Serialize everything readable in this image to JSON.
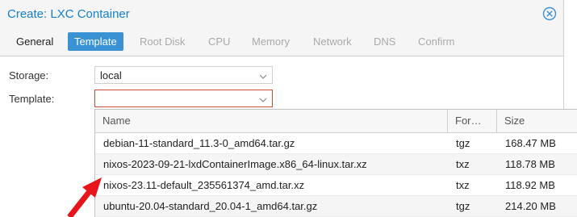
{
  "window": {
    "title": "Create: LXC Container",
    "close_icon": "close-circle-icon"
  },
  "tabs": [
    {
      "label": "General",
      "state": "enabled"
    },
    {
      "label": "Template",
      "state": "active"
    },
    {
      "label": "Root Disk",
      "state": "disabled"
    },
    {
      "label": "CPU",
      "state": "disabled"
    },
    {
      "label": "Memory",
      "state": "disabled"
    },
    {
      "label": "Network",
      "state": "disabled"
    },
    {
      "label": "DNS",
      "state": "disabled"
    },
    {
      "label": "Confirm",
      "state": "disabled"
    }
  ],
  "form": {
    "storage_label": "Storage:",
    "storage_value": "local",
    "template_label": "Template:",
    "template_value": ""
  },
  "template_picker": {
    "columns": [
      "Name",
      "For…",
      "Size"
    ],
    "rows": [
      {
        "name": "debian-11-standard_11.3-0_amd64.tar.gz",
        "format": "tgz",
        "size": "168.47 MB"
      },
      {
        "name": "nixos-2023-09-21-lxdContainerImage.x86_64-linux.tar.xz",
        "format": "txz",
        "size": "118.78 MB"
      },
      {
        "name": "nixos-23.11-default_235561374_amd.tar.xz",
        "format": "txz",
        "size": "118.92 MB"
      },
      {
        "name": "ubuntu-20.04-standard_20.04-1_amd64.tar.gz",
        "format": "tgz",
        "size": "214.20 MB"
      }
    ]
  },
  "colors": {
    "accent": "#157fcc",
    "active_tab": "#3892d4",
    "invalid_border": "#cf4c35",
    "annotation_arrow": "#e8141b"
  }
}
